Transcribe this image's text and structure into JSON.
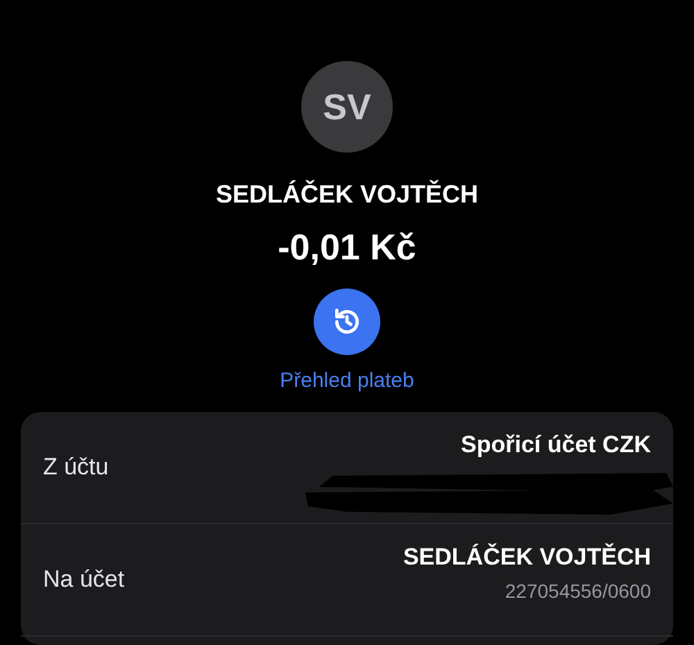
{
  "contact": {
    "initials": "SV",
    "name": "SEDLÁČEK VOJTĚCH",
    "amount": "-0,01 Kč"
  },
  "history_link": {
    "label": "Přehled plateb"
  },
  "details": [
    {
      "label": "Z účtu",
      "value": "Spořicí účet CZK",
      "redacted": true
    },
    {
      "label": "Na účet",
      "value": "SEDLÁČEK VOJTĚCH",
      "subvalue": "227054556/0600",
      "redacted": false
    }
  ]
}
